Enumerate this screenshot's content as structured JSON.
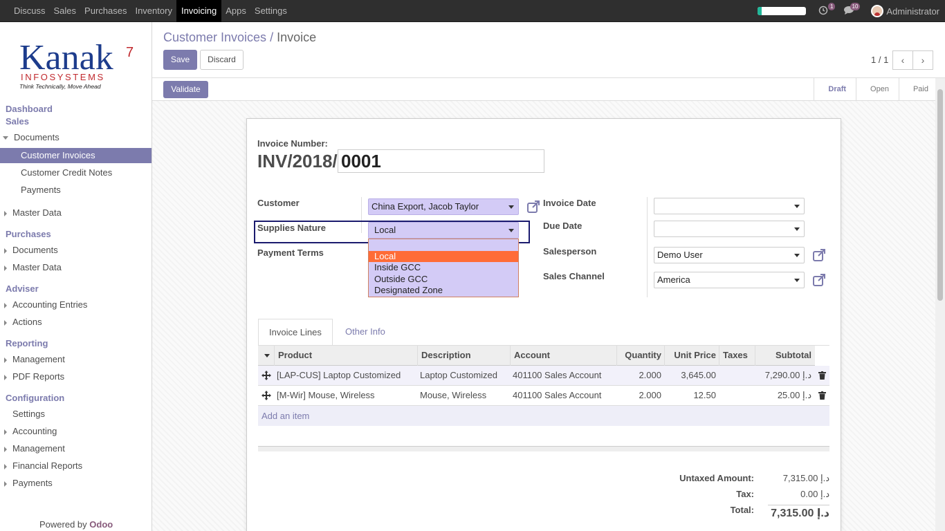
{
  "topbar": {
    "menu": [
      "Discuss",
      "Sales",
      "Purchases",
      "Inventory",
      "Invoicing",
      "Apps",
      "Settings"
    ],
    "active_menu": "Invoicing",
    "progress": 0.08,
    "activity_count": "1",
    "messages_count": "10",
    "user": "Administrator"
  },
  "sidebar": {
    "logo": {
      "name": "Kanak",
      "sub": "INFOSYSTEMS",
      "tagline": "Think Technically, Move Ahead",
      "mark": "7"
    },
    "dashboard": "Dashboard",
    "sales": "Sales",
    "sales_documents": "Documents",
    "customer_invoices": "Customer Invoices",
    "customer_credit_notes": "Customer Credit Notes",
    "payments": "Payments",
    "sales_master_data": "Master Data",
    "purchases": "Purchases",
    "purchases_documents": "Documents",
    "purchases_master_data": "Master Data",
    "adviser": "Adviser",
    "accounting_entries": "Accounting Entries",
    "actions": "Actions",
    "reporting": "Reporting",
    "management": "Management",
    "pdf_reports": "PDF Reports",
    "configuration": "Configuration",
    "settings": "Settings",
    "accounting": "Accounting",
    "config_management": "Management",
    "financial_reports": "Financial Reports",
    "config_payments": "Payments",
    "powered_by": "Powered by",
    "powered_brand": "Odoo"
  },
  "control": {
    "breadcrumb_parent": "Customer Invoices",
    "breadcrumb_sep": "/",
    "breadcrumb_current": "Invoice",
    "save_label": "Save",
    "discard_label": "Discard",
    "pager": "1 / 1",
    "prev": "‹",
    "next": "›"
  },
  "status": {
    "validate_label": "Validate",
    "stages": [
      "Draft",
      "Open",
      "Paid"
    ],
    "active_stage": "Draft"
  },
  "form": {
    "invoice_number_label": "Invoice Number:",
    "invoice_prefix": "INV/2018/",
    "invoice_suffix": "0001",
    "customer_label": "Customer",
    "customer_value": "China Export, Jacob Taylor",
    "supplies_nature_label": "Supplies Nature",
    "supplies_nature_value": "Local",
    "payment_terms_label": "Payment Terms",
    "invoice_date_label": "Invoice Date",
    "invoice_date_value": "",
    "due_date_label": "Due Date",
    "due_date_value": "",
    "salesperson_label": "Salesperson",
    "salesperson_value": "Demo User",
    "sales_channel_label": "Sales Channel",
    "sales_channel_value": "America",
    "supplies_nature_options": [
      "Local",
      "Inside GCC",
      "Outside GCC",
      "Designated Zone"
    ],
    "supplies_nature_selected": "Local"
  },
  "notebook": {
    "tabs": [
      "Invoice Lines",
      "Other Info"
    ],
    "active_tab": "Invoice Lines"
  },
  "lines": {
    "headers": [
      "Product",
      "Description",
      "Account",
      "Quantity",
      "Unit Price",
      "Taxes",
      "Subtotal"
    ],
    "rows": [
      {
        "product": "[LAP-CUS] Laptop Customized",
        "description": "Laptop Customized",
        "account": "401100 Sales Account",
        "quantity": "2.000",
        "unit_price": "3,645.00",
        "taxes": "",
        "subtotal": "7,290.00 د.إ"
      },
      {
        "product": "[M-Wir] Mouse, Wireless",
        "description": "Mouse, Wireless",
        "account": "401100 Sales Account",
        "quantity": "2.000",
        "unit_price": "12.50",
        "taxes": "",
        "subtotal": "25.00 د.إ"
      }
    ],
    "add_item": "Add an item"
  },
  "totals": {
    "untaxed_label": "Untaxed Amount:",
    "untaxed_value": "7,315.00 د.إ",
    "tax_label": "Tax:",
    "tax_value": "0.00 د.إ",
    "total_label": "Total:",
    "total_value": "7,315.00 د.إ"
  },
  "colors": {
    "brand": "#7c7bad",
    "odoo": "#875a7b",
    "field_highlight": "#d3cbf6",
    "selected_option": "#ff6c37"
  }
}
